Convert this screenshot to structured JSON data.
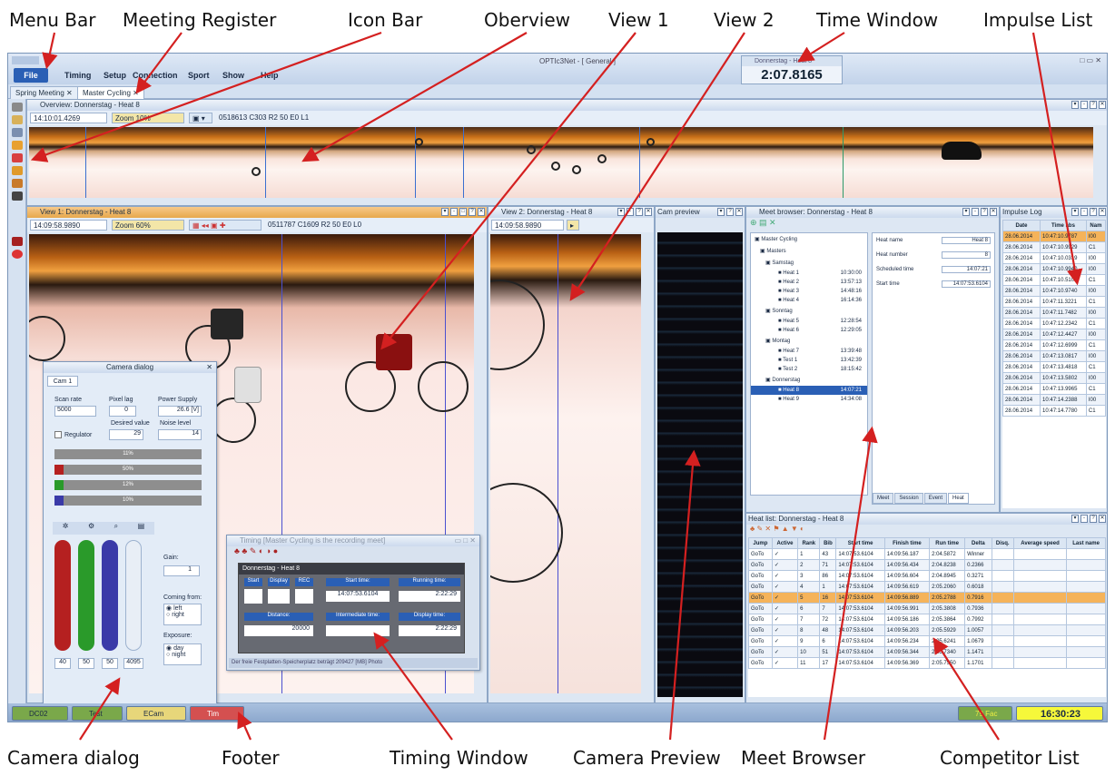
{
  "callouts": {
    "menu_bar": "Menu Bar",
    "meeting_register": "Meeting Register",
    "icon_bar": "Icon Bar",
    "overview": "Oberview",
    "view1": "View 1",
    "view2": "View 2",
    "time_window": "Time Window",
    "impulse_list": "Impulse List",
    "camera_dialog": "Camera dialog",
    "footer": "Footer",
    "timing_window": "Timing Window",
    "camera_preview": "Camera Preview",
    "meet_browser": "Meet Browser",
    "competitor_list": "Competitor List"
  },
  "app": {
    "title": "OPTIc3Net - [ General ]",
    "menu": {
      "file": "File",
      "items": [
        "Timing",
        "Setup",
        "Connection",
        "Sport",
        "Show",
        "Help"
      ]
    },
    "tabs": [
      "Spring Meeting",
      "Master Cycling"
    ],
    "time_window": {
      "title": "Donnerstag - Heat 8",
      "value": "2:07.8165"
    },
    "overview": {
      "title": "Overview: Donnerstag - Heat 8",
      "time": "14:10:01.4269",
      "zoom": "Zoom 10%",
      "info": "0518613 C303 R2 50 E0 L1"
    },
    "view1": {
      "title": "View 1: Donnerstag - Heat 8",
      "time": "14:09:58.9890",
      "zoom": "Zoom 60%",
      "info": "0511787 C1609 R2 50 E0 L0"
    },
    "view2": {
      "title": "View 2: Donnerstag - Heat 8",
      "time": "14:09:58.9890"
    },
    "cam_preview": {
      "title": "Cam preview"
    },
    "camera_dialog": {
      "title": "Camera dialog",
      "tab": "Cam 1",
      "scan_rate_label": "Scan rate",
      "scan_rate": "5000",
      "pixel_lag_label": "Pixel lag",
      "pixel_lag": "0",
      "power_label": "Power Supply",
      "power": "26.6 [V]",
      "desired_label": "Desired value",
      "desired": "29",
      "noise_label": "Noise level",
      "noise": "14",
      "regulator": "Regulator",
      "bars": [
        "11%",
        "50%",
        "12%",
        "10%"
      ],
      "slider_values": [
        "40",
        "50",
        "50",
        "4095"
      ],
      "gain_label": "Gain:",
      "gain": "1",
      "coming_from": "Coming from:",
      "left": "left",
      "right": "right",
      "exposure": "Exposure:",
      "day": "day",
      "night": "night"
    },
    "timing": {
      "title": "Timing [Master Cycling is the recording meet]",
      "heat": "Donnerstag - Heat 8",
      "labels": [
        "Start",
        "Display",
        "REC"
      ],
      "start_time_label": "Start time:",
      "start_time": "14:07:53.6104",
      "running_label": "Running time:",
      "running": "2:22:29",
      "distance_label": "Distance:",
      "distance": "20000",
      "intermediate_label": "Intermediate time:",
      "intermediate": "",
      "display_label": "Display time:",
      "display": "2:22:29",
      "status": "Der freie Festplatten-Speicherplatz beträgt 209427 [MB] Photo"
    },
    "meet_browser": {
      "title": "Meet browser: Donnerstag - Heat 8",
      "root": "Master Cycling",
      "group": "Masters",
      "days": [
        {
          "name": "Samstag",
          "heats": [
            [
              "Heat 1",
              "10:30:00"
            ],
            [
              "Heat 2",
              "13:57:13"
            ],
            [
              "Heat 3",
              "14:48:16"
            ],
            [
              "Heat 4",
              "16:14:36"
            ]
          ]
        },
        {
          "name": "Sonntag",
          "heats": [
            [
              "Heat 5",
              "12:28:54"
            ],
            [
              "Heat 6",
              "12:29:05"
            ]
          ]
        },
        {
          "name": "Montag",
          "heats": [
            [
              "Heat 7",
              "13:39:48"
            ],
            [
              "Test 1",
              "13:42:39"
            ],
            [
              "Test 2",
              "18:15:42"
            ]
          ]
        },
        {
          "name": "Donnerstag",
          "heats": [
            [
              "Heat 8",
              "14:07:21"
            ],
            [
              "Heat 9",
              "14:34:08"
            ]
          ]
        }
      ],
      "props": [
        [
          "Heat name",
          "Heat 8"
        ],
        [
          "Heat number",
          "8"
        ],
        [
          "Scheduled time",
          "14:07:21"
        ],
        [
          "Start time",
          "14:07:53.6104"
        ]
      ],
      "bottom_tabs": [
        "Meet",
        "Session",
        "Event",
        "Heat"
      ]
    },
    "impulse_log": {
      "title": "Impulse Log",
      "cols": [
        "Date",
        "Time abs",
        "Nam"
      ],
      "rows": [
        [
          "28.06.2014",
          "10:47:10.9787",
          "I00"
        ],
        [
          "28.06.2014",
          "10:47:10.9929",
          "C1"
        ],
        [
          "28.06.2014",
          "10:47:10.0319",
          "I00"
        ],
        [
          "28.06.2014",
          "10:47:10.9940",
          "I00"
        ],
        [
          "28.06.2014",
          "10:47:10.5103",
          "C1"
        ],
        [
          "28.06.2014",
          "10:47:10.9740",
          "I00"
        ],
        [
          "28.06.2014",
          "10:47:11.3221",
          "C1"
        ],
        [
          "28.06.2014",
          "10:47:11.7482",
          "I00"
        ],
        [
          "28.06.2014",
          "10:47:12.2342",
          "C1"
        ],
        [
          "28.06.2014",
          "10:47:12.4427",
          "I00"
        ],
        [
          "28.06.2014",
          "10:47:12.6999",
          "C1"
        ],
        [
          "28.06.2014",
          "10:47:13.0817",
          "I00"
        ],
        [
          "28.06.2014",
          "10:47:13.4818",
          "C1"
        ],
        [
          "28.06.2014",
          "10:47:13.5802",
          "I00"
        ],
        [
          "28.06.2014",
          "10:47:13.9965",
          "C1"
        ],
        [
          "28.06.2014",
          "10:47:14.2388",
          "I00"
        ],
        [
          "28.06.2014",
          "10:47:14.7780",
          "C1"
        ]
      ]
    },
    "heat_list": {
      "title": "Heat list: Donnerstag - Heat 8",
      "cols": [
        "Jump",
        "Active",
        "Rank",
        "Bib",
        "Start time",
        "Finish time",
        "Run time",
        "Delta",
        "Disq.",
        "Average speed",
        "Last name"
      ],
      "rows": [
        [
          "GoTo",
          "✓",
          "1",
          "43",
          "14:07:53.6104",
          "14:09:56.187",
          "2:04.5872",
          "Winner"
        ],
        [
          "GoTo",
          "✓",
          "2",
          "71",
          "14:07:53.6104",
          "14:09:56.434",
          "2:04.8238",
          "0.2366"
        ],
        [
          "GoTo",
          "✓",
          "3",
          "86",
          "14:07:53.6104",
          "14:09:56.604",
          "2:04.8945",
          "0.3271"
        ],
        [
          "GoTo",
          "✓",
          "4",
          "1",
          "14:07:53.6104",
          "14:09:56.619",
          "2:05.2060",
          "0.6018"
        ],
        [
          "GoTo",
          "✓",
          "5",
          "16",
          "14:07:53.6104",
          "14:09:56.889",
          "2:05.2788",
          "0.7916"
        ],
        [
          "GoTo",
          "✓",
          "6",
          "7",
          "14:07:53.6104",
          "14:09:56.991",
          "2:05.3808",
          "0.7936"
        ],
        [
          "GoTo",
          "✓",
          "7",
          "72",
          "14:07:53.6104",
          "14:09:56.186",
          "2:05.3864",
          "0.7992"
        ],
        [
          "GoTo",
          "✓",
          "8",
          "48",
          "14:07:53.6104",
          "14:09:56.203",
          "2:05.5929",
          "1.0057"
        ],
        [
          "GoTo",
          "✓",
          "9",
          "6",
          "14:07:53.6104",
          "14:09:56.234",
          "2:05.6241",
          "1.0679"
        ],
        [
          "GoTo",
          "✓",
          "10",
          "51",
          "14:07:53.6104",
          "14:09:56.344",
          "2:05.7340",
          "1.1471"
        ],
        [
          "GoTo",
          "✓",
          "11",
          "17",
          "14:07:53.6104",
          "14:09:56.369",
          "2:05.7550",
          "1.1701"
        ]
      ]
    },
    "footer": {
      "buttons": [
        "DC02",
        "Test",
        "ECam",
        "Tim"
      ],
      "disk": "79 Fac",
      "clock": "16:30:23"
    }
  },
  "colors": {
    "accent": "#2a5fb5",
    "highlight": "#f5b35a",
    "clock_bg": "#f6f83a"
  }
}
